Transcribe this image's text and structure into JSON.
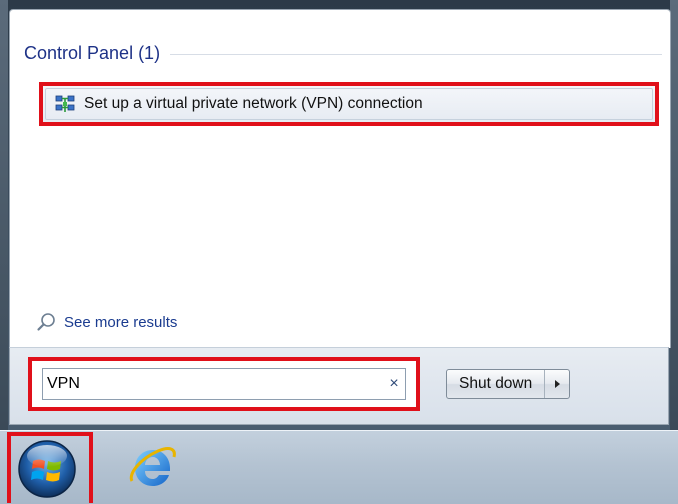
{
  "results": {
    "group_title": "Control Panel (1)",
    "items": [
      {
        "label": "Set up a virtual private network (VPN) connection",
        "icon": "network-icon"
      }
    ],
    "see_more": "See more results"
  },
  "search": {
    "value": "VPN",
    "clear_glyph": "×"
  },
  "power": {
    "shutdown_label": "Shut down"
  },
  "taskbar": {
    "start_icon": "windows-orb-icon",
    "pinned": [
      "internet-explorer-icon"
    ]
  },
  "colors": {
    "highlight_border": "#e0101a",
    "header_text": "#1e3287",
    "link_text": "#1a3b8f"
  }
}
